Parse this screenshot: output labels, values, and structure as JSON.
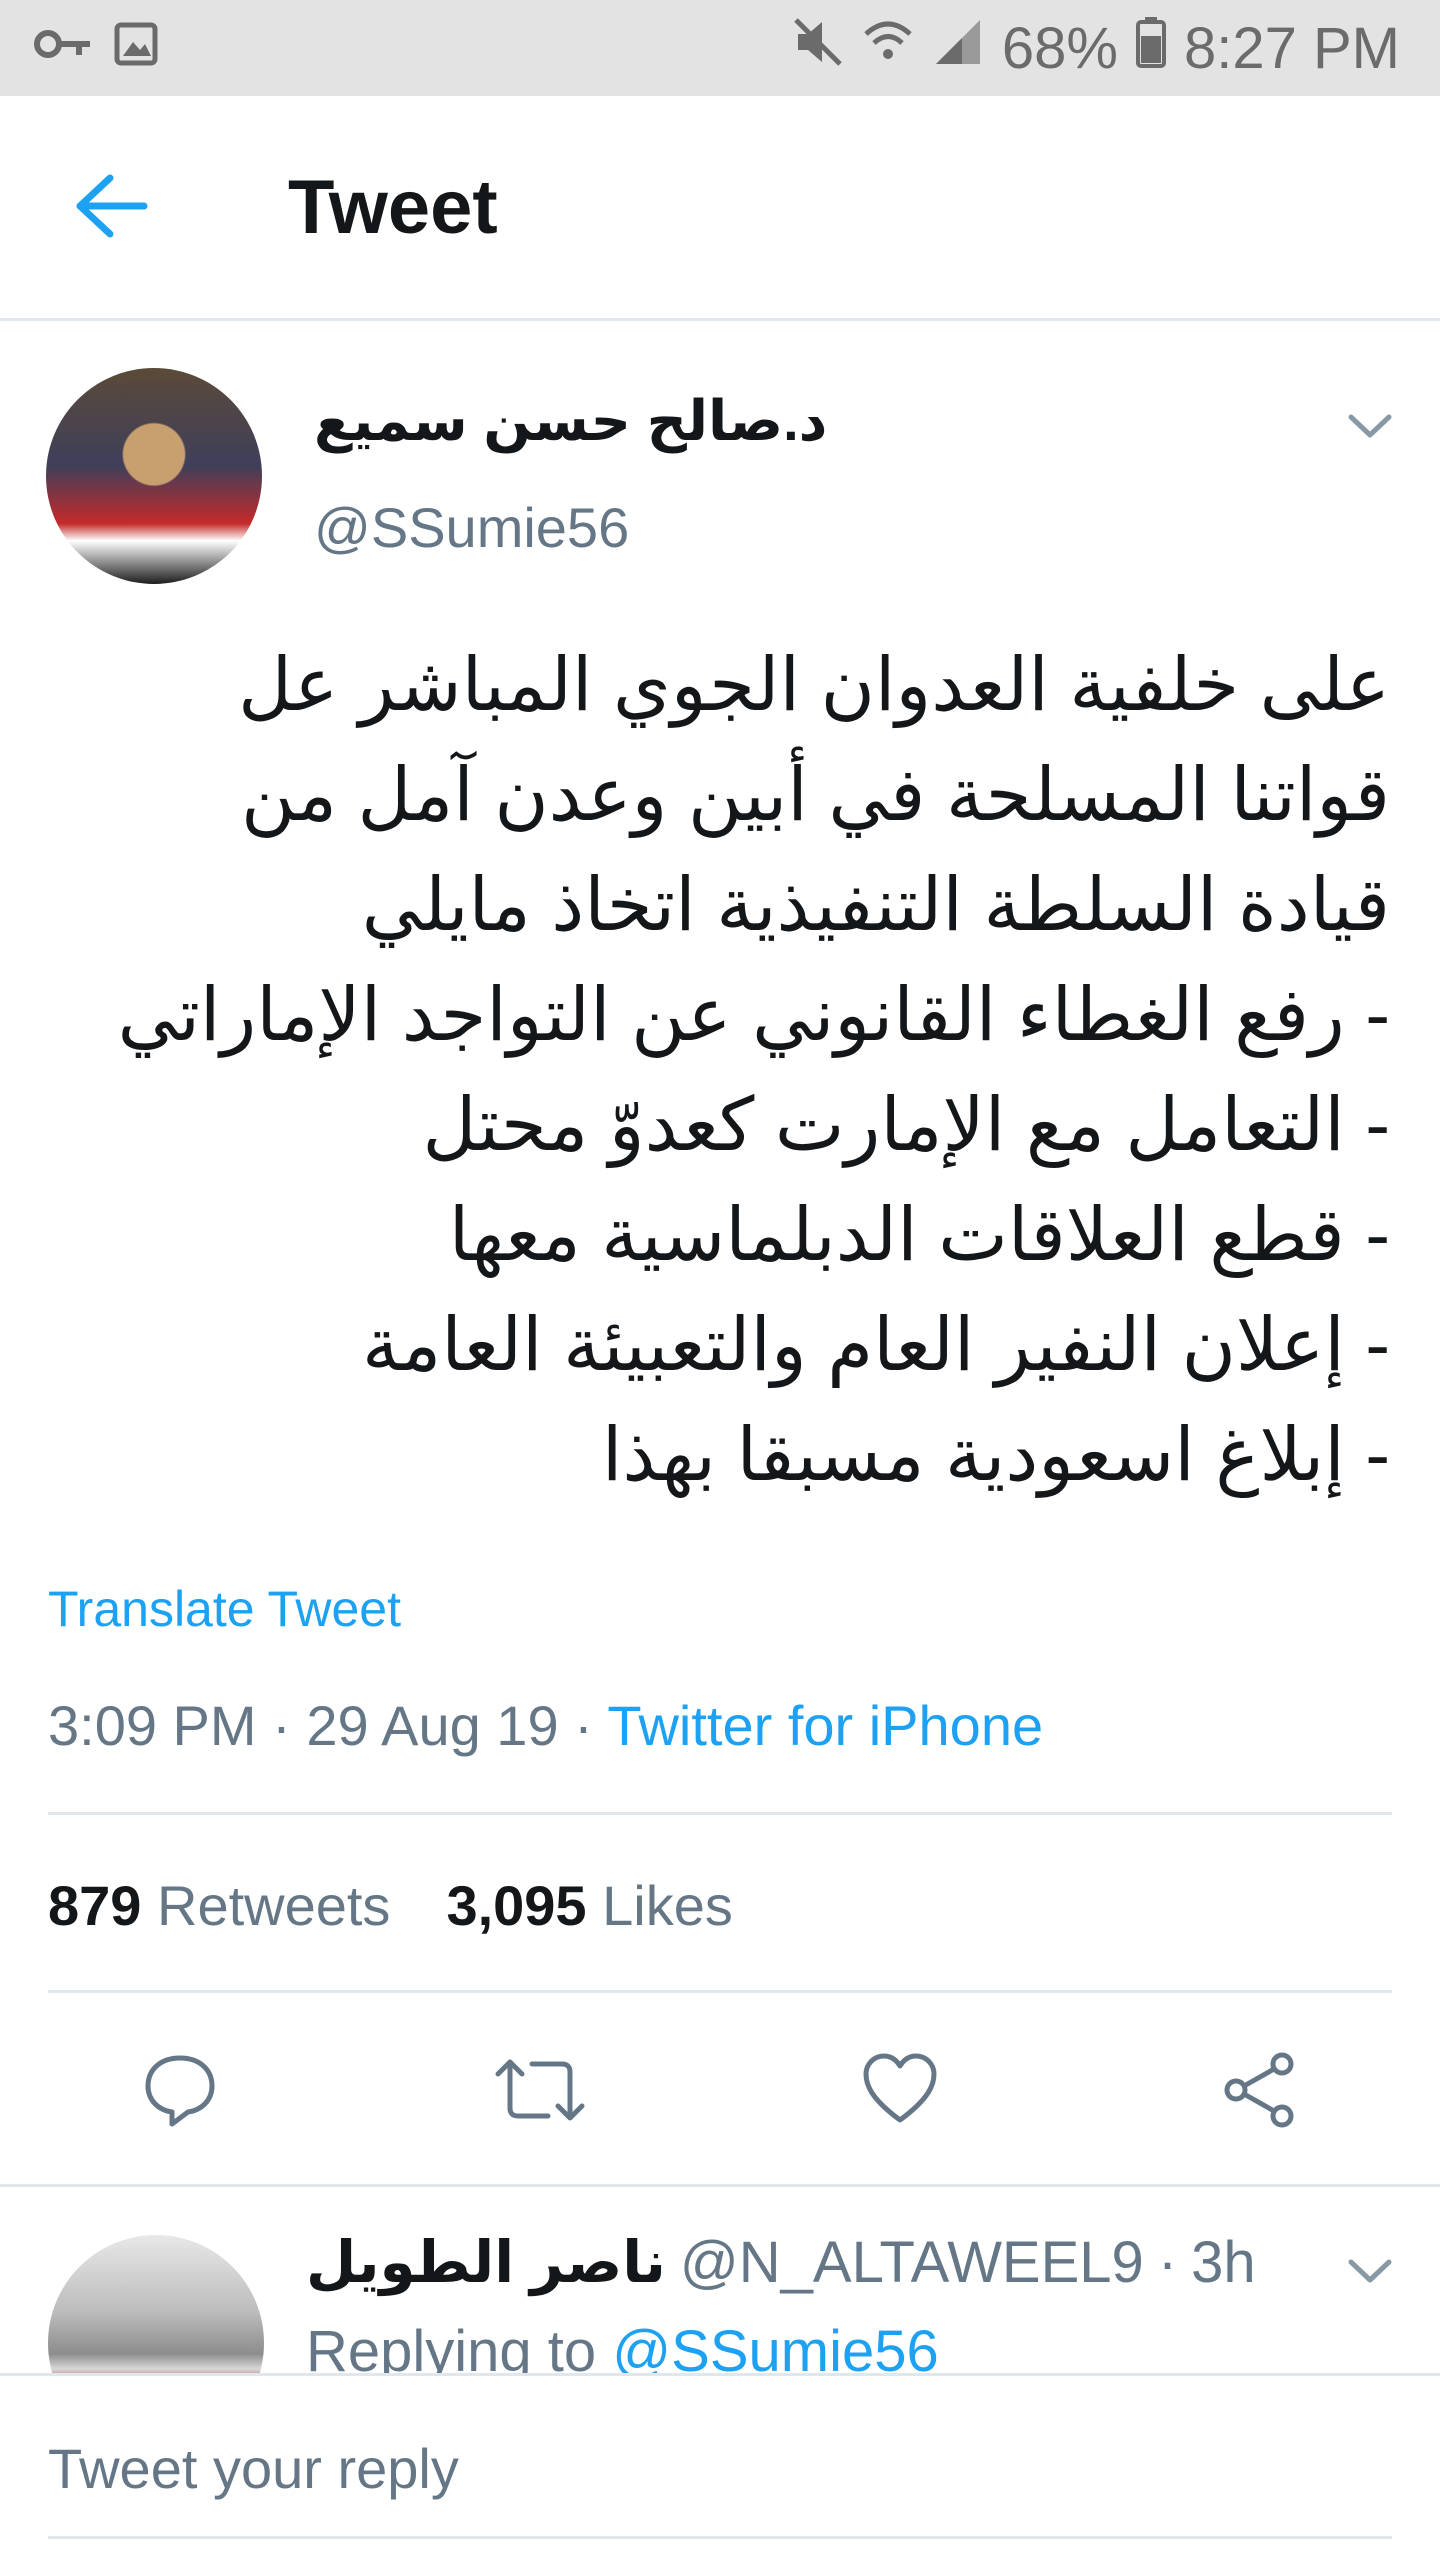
{
  "status_bar": {
    "battery": "68%",
    "time": "8:27 PM"
  },
  "header": {
    "title": "Tweet"
  },
  "tweet": {
    "author_name": "د.صالح حسن سميع",
    "handle": "@SSumie56",
    "text_lines": [
      "على خلفية العدوان الجوي المباشر عل",
      "قواتنا المسلحة في أبين وعدن آمل من",
      "قيادة السلطة التنفيذية اتخاذ مايلي",
      "- رفع الغطاء القانوني عن التواجد الإماراتي",
      "- التعامل مع الإمارت كعدوّ محتل",
      "- قطع العلاقات الدبلماسية معها",
      "- إعلان النفير العام والتعبيئة العامة",
      "- إبلاغ اسعودية مسبقا بهذا"
    ],
    "translate_label": "Translate Tweet",
    "time": "3:09 PM",
    "date": "29 Aug 19",
    "source": "Twitter for iPhone",
    "retweets_count": "879",
    "retweets_label": "Retweets",
    "likes_count": "3,095",
    "likes_label": "Likes"
  },
  "reply": {
    "author_name": "ناصر الطويل",
    "handle": "@N_ALTAWEEL9",
    "age": "3h",
    "replying_prefix": "Replying to",
    "replying_to": "@SSumie56"
  },
  "composer": {
    "placeholder": "Tweet your reply"
  },
  "colors": {
    "accent": "#1da1f2",
    "secondary_text": "#657786",
    "divider": "#e1e8ed"
  },
  "icons": [
    "key-icon",
    "image-icon",
    "mute-icon",
    "wifi-icon",
    "signal-icon",
    "battery-icon",
    "back-arrow-icon",
    "chevron-down-icon",
    "reply-icon",
    "retweet-icon",
    "like-icon",
    "share-icon"
  ]
}
